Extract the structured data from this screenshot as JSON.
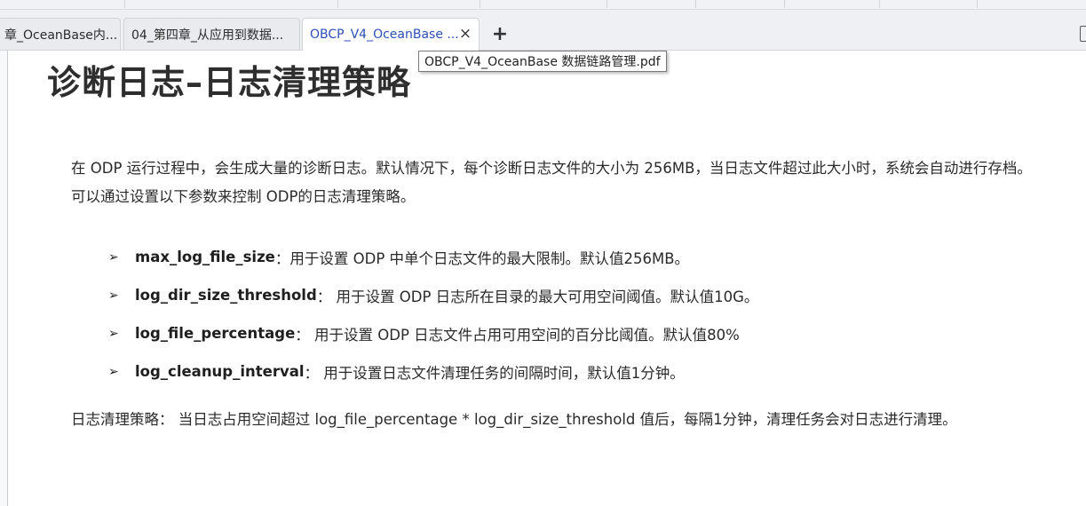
{
  "tabs": [
    {
      "label": "章_OceanBase内..."
    },
    {
      "label": "04_第四章_从应用到数据..."
    },
    {
      "label": "OBCP_V4_OceanBase ...",
      "active": true
    }
  ],
  "tooltip": "OBCP_V4_OceanBase 数据链路管理.pdf",
  "document": {
    "title": "诊断日志–日志清理策略",
    "intro": "在 ODP 运行过程中，会生成大量的诊断日志。默认情况下，每个诊断日志文件的大小为 256MB，当日志文件超过此大小时，系统会自动进行存档。可以通过设置以下参数来控制 ODP的日志清理策略。",
    "bullets": [
      {
        "param": "max_log_file_size",
        "desc": "：用于设置 ODP 中单个日志文件的最大限制。默认值256MB。"
      },
      {
        "param": "log_dir_size_threshold",
        "desc": "： 用于设置 ODP 日志所在目录的最大可用空间阈值。默认值10G。"
      },
      {
        "param": "log_file_percentage",
        "desc": "： 用于设置 ODP 日志文件占用可用空间的百分比阈值。默认值80%"
      },
      {
        "param": "log_cleanup_interval",
        "desc": "： 用于设置日志文件清理任务的间隔时间，默认值1分钟。"
      }
    ],
    "bullet_marker": "➢",
    "strategy": "日志清理策略： 当日志占用空间超过 log_file_percentage * log_dir_size_threshold 值后，每隔1分钟，清理任务会对日志进行清理。"
  },
  "icons": {
    "close": "×",
    "new_tab": "+"
  }
}
